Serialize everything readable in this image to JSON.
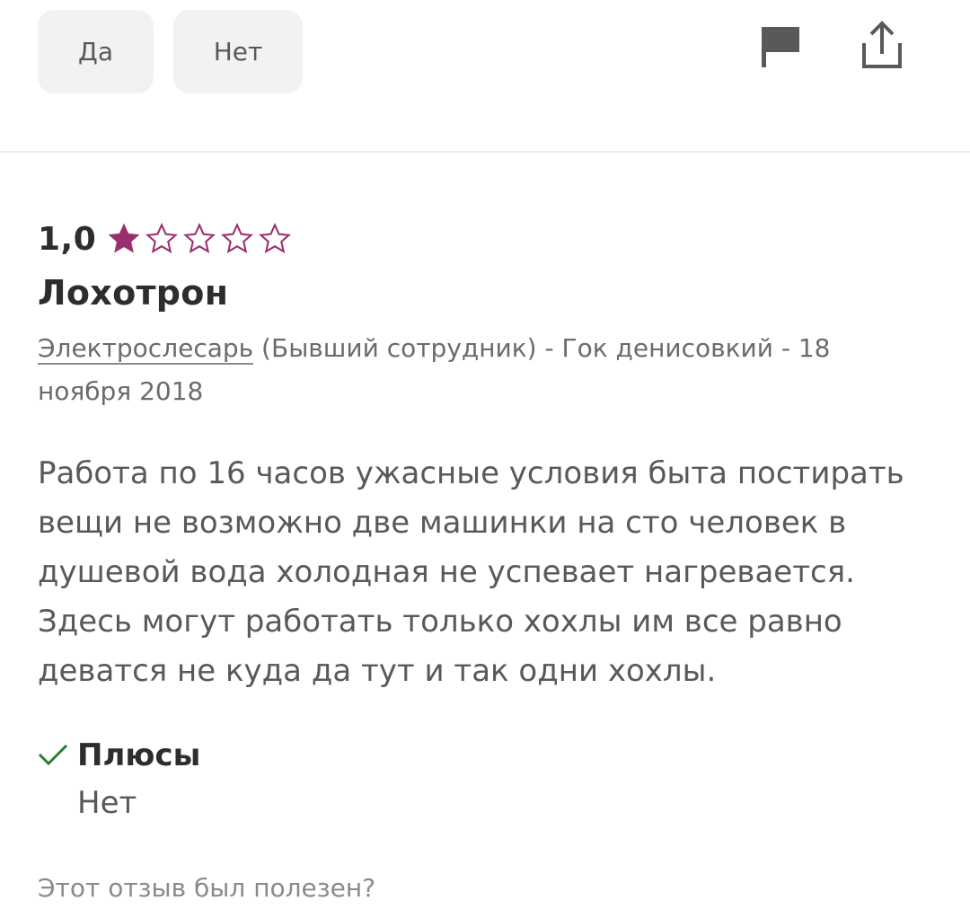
{
  "vote": {
    "yes_label": "Да",
    "no_label": "Нет"
  },
  "actions": {
    "flag_icon": "flag-icon",
    "share_icon": "share-icon"
  },
  "review": {
    "rating": "1,0",
    "stars_filled": 1,
    "stars_total": 5,
    "star_color": "#9b2f6e",
    "title": "Лохотрон",
    "job_title": "Электрослесарь",
    "meta_rest": " (Бывший сотрудник) - Гок денисовкий - 18 ноября 2018",
    "body": "Работа по 16 часов ужасные условия быта постирать вещи не возможно две машинки на сто человек в душевой вода холодная не успевает нагревается. Здесь могут работать только хохлы им все равно деватся не куда да тут и так одни хохлы.",
    "pros_title": "Плюсы",
    "pros_value": "Нет",
    "check_color": "#2f7d3b",
    "helpful_question": "Этот отзыв был полезен?"
  }
}
